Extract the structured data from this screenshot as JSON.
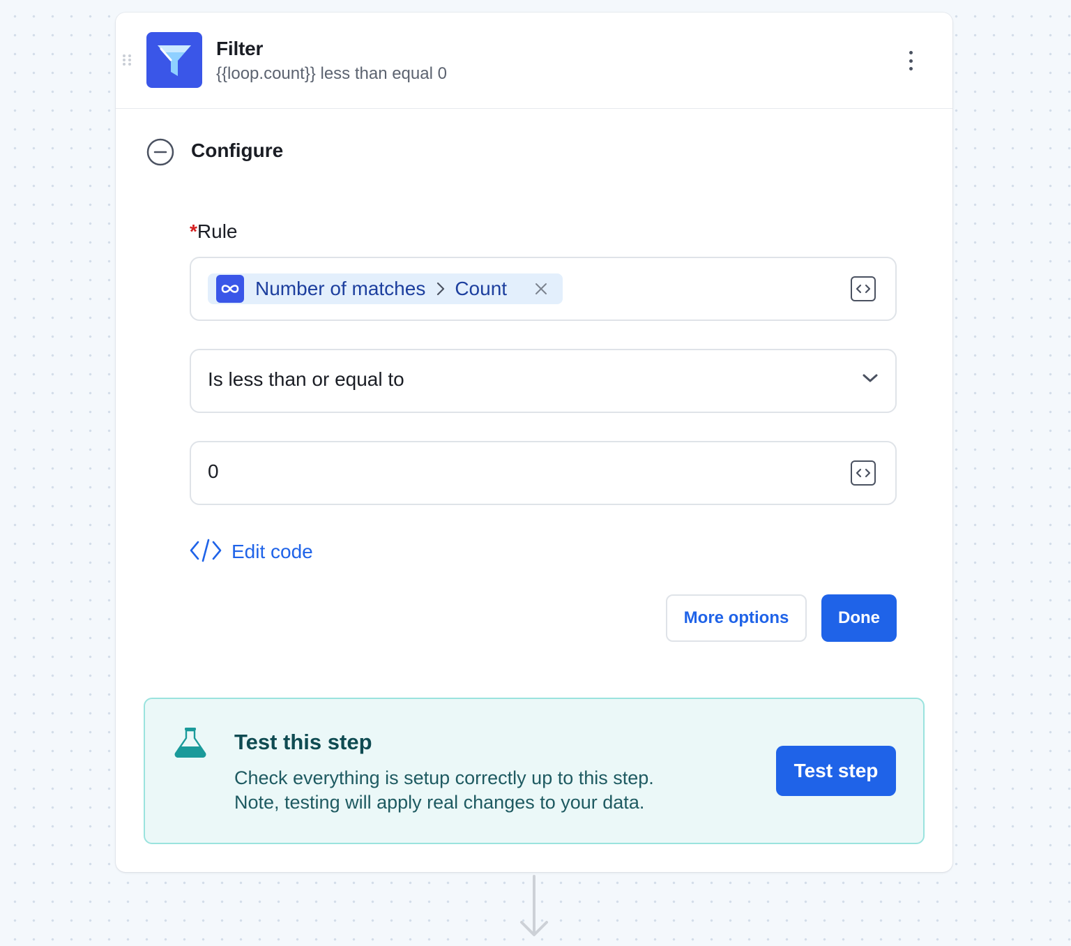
{
  "step": {
    "title": "Filter",
    "subtitle": "{{loop.count}} less than equal 0",
    "icon": "filter-funnel-icon",
    "icon_color": "#3a56e8"
  },
  "configure": {
    "section_title": "Configure",
    "rule_required_mark": "*",
    "rule_label": "Rule",
    "field_pill": {
      "icon": "loop-infinity-icon",
      "parent": "Number of matches",
      "child": "Count"
    },
    "operator": "Is less than or equal to",
    "value": "0",
    "edit_code_label": "Edit code",
    "more_options_label": "More options",
    "done_label": "Done"
  },
  "test_panel": {
    "title": "Test this step",
    "description_line1": "Check everything is setup correctly up to this step.",
    "description_line2": "Note, testing will apply real changes to your data.",
    "button_label": "Test step"
  },
  "colors": {
    "accent": "#1f63e8",
    "test_panel_bg": "#ebf8f8",
    "test_panel_border": "#9ae3de",
    "required": "#d42020"
  }
}
